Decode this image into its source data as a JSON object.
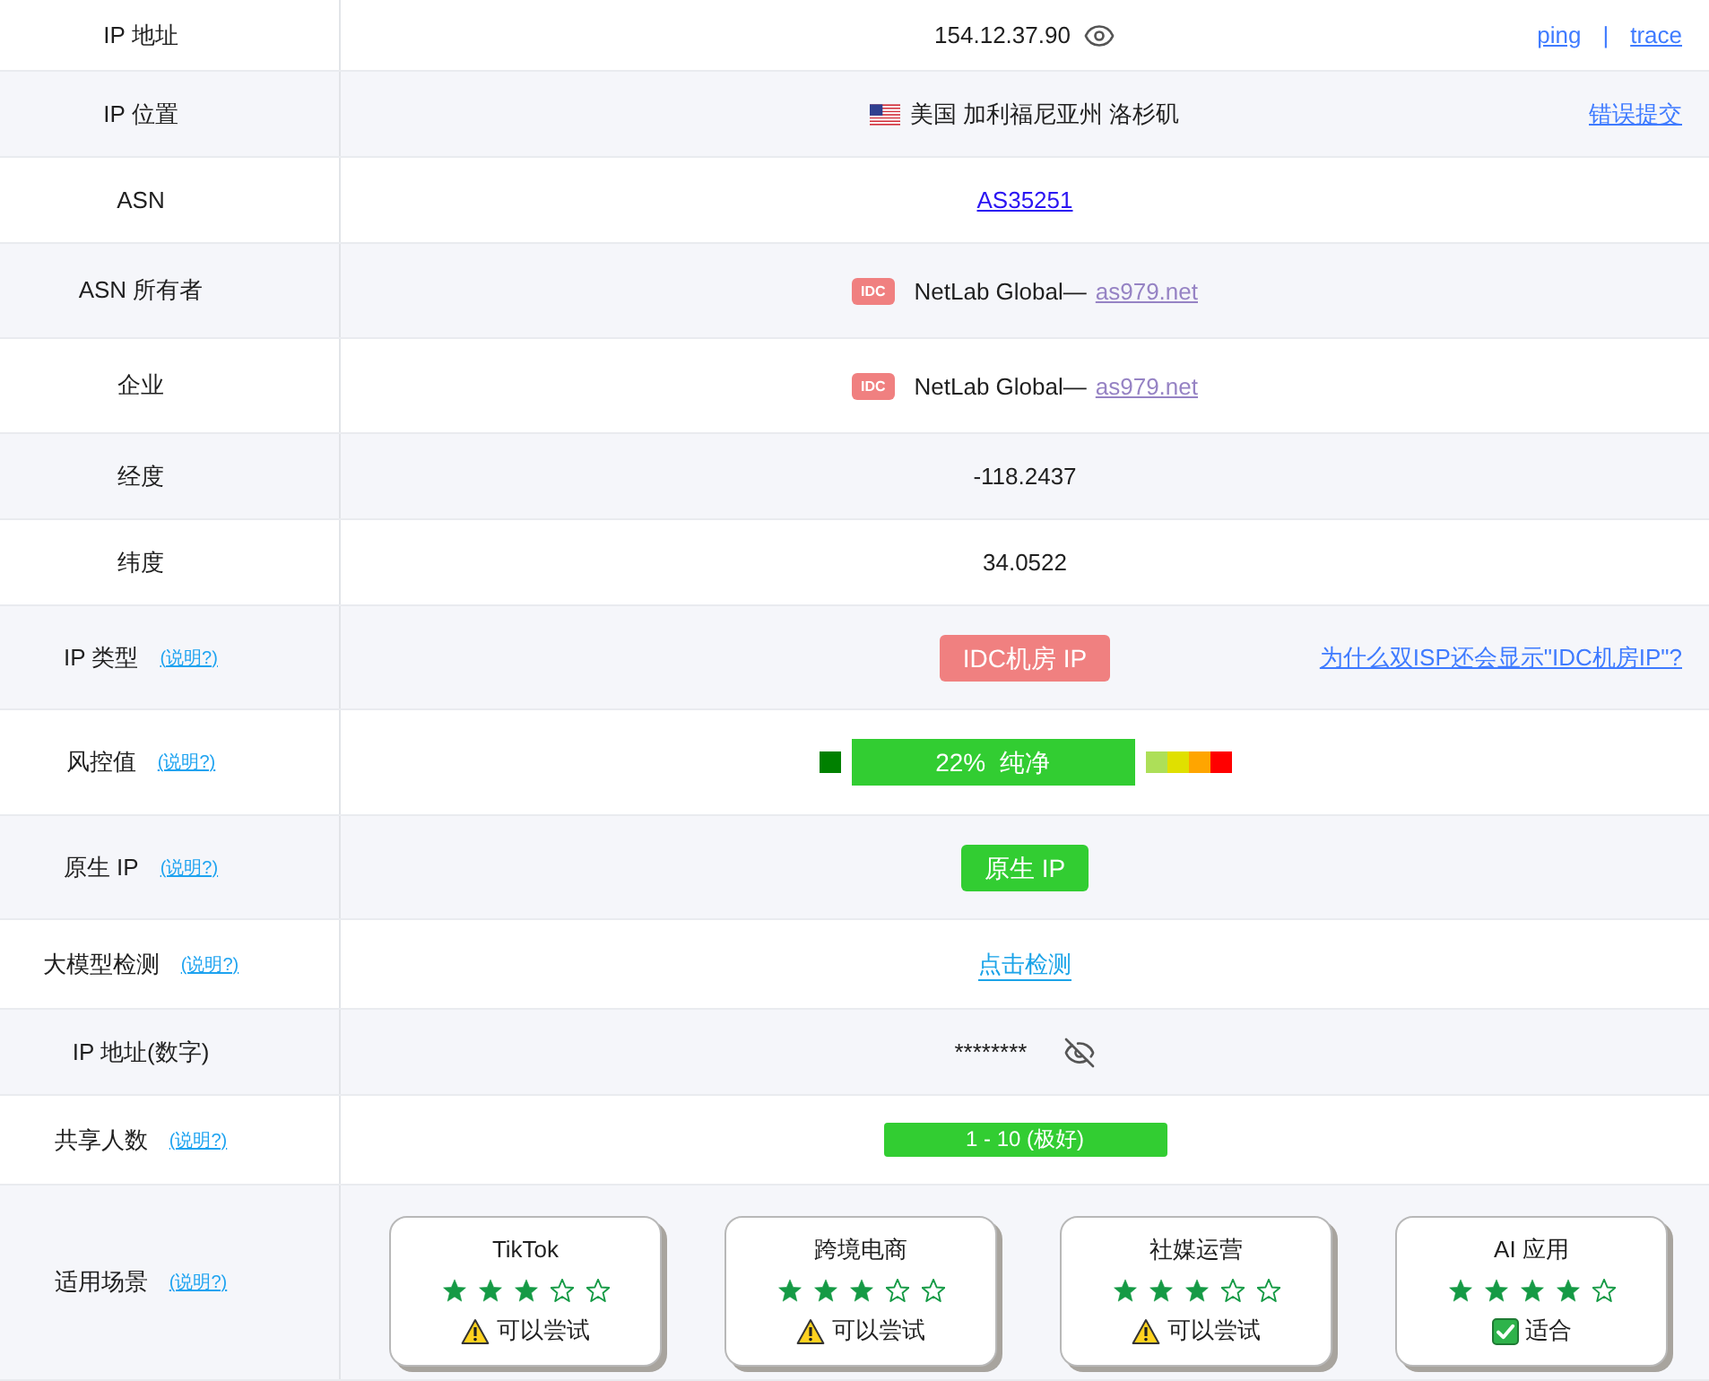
{
  "rows": [
    {
      "kind": "ip",
      "label": "IP 地址",
      "value": "154.12.37.90",
      "masked": false,
      "actions": [
        "ping",
        "trace"
      ],
      "separator": "|"
    },
    {
      "kind": "location",
      "label": "IP 位置",
      "value": "美国 加利福尼亚州 洛杉矶",
      "action": "错误提交"
    },
    {
      "kind": "link",
      "label": "ASN",
      "value": "AS35251"
    },
    {
      "kind": "org",
      "label": "ASN 所有者",
      "tag": "IDC",
      "name": "NetLab Global—",
      "link": "as979.net"
    },
    {
      "kind": "org",
      "label": "企业",
      "tag": "IDC",
      "name": "NetLab Global—",
      "link": "as979.net"
    },
    {
      "kind": "text",
      "label": "经度",
      "value": "-118.2437"
    },
    {
      "kind": "text",
      "label": "纬度",
      "value": "34.0522"
    },
    {
      "kind": "badge",
      "label": "IP 类型",
      "help": "(说明?)",
      "badge": {
        "text": "IDC机房 IP",
        "color": "#f08080"
      },
      "action": "为什么双ISP还会显示\"IDC机房IP\"?"
    },
    {
      "kind": "risk",
      "label": "风控值",
      "help": "(说明?)",
      "segments": [
        {
          "color": "#008000",
          "selected": false
        },
        {
          "color": "#32cd32",
          "selected": true,
          "text": "22%  纯净"
        },
        {
          "color": "#addf58",
          "selected": false
        },
        {
          "color": "#e0e000",
          "selected": false
        },
        {
          "color": "#ffa500",
          "selected": false
        },
        {
          "color": "#ff0000",
          "selected": false
        }
      ]
    },
    {
      "kind": "badge",
      "label": "原生 IP",
      "help": "(说明?)",
      "badge": {
        "text": "原生 IP",
        "color": "#32cd32"
      }
    },
    {
      "kind": "check",
      "label": "大模型检测",
      "help": "(说明?)",
      "value": "点击检测"
    },
    {
      "kind": "ip",
      "label": "IP 地址(数字)",
      "value": "********",
      "masked": true
    },
    {
      "kind": "bar",
      "label": "共享人数",
      "help": "(说明?)",
      "badge": {
        "text": "1 - 10 (极好)",
        "color": "#32cd32"
      }
    },
    {
      "kind": "cards",
      "label": "适用场景",
      "help": "(说明?)",
      "cards": [
        {
          "name": "TikTok",
          "stars": 3,
          "verdict": {
            "kind": "warning",
            "text": "可以尝试"
          }
        },
        {
          "name": "跨境电商",
          "stars": 3,
          "verdict": {
            "kind": "warning",
            "text": "可以尝试"
          }
        },
        {
          "name": "社媒运营",
          "stars": 3,
          "verdict": {
            "kind": "warning",
            "text": "可以尝试"
          }
        },
        {
          "name": "AI 应用",
          "stars": 4,
          "verdict": {
            "kind": "ok",
            "text": "适合"
          }
        }
      ]
    }
  ]
}
